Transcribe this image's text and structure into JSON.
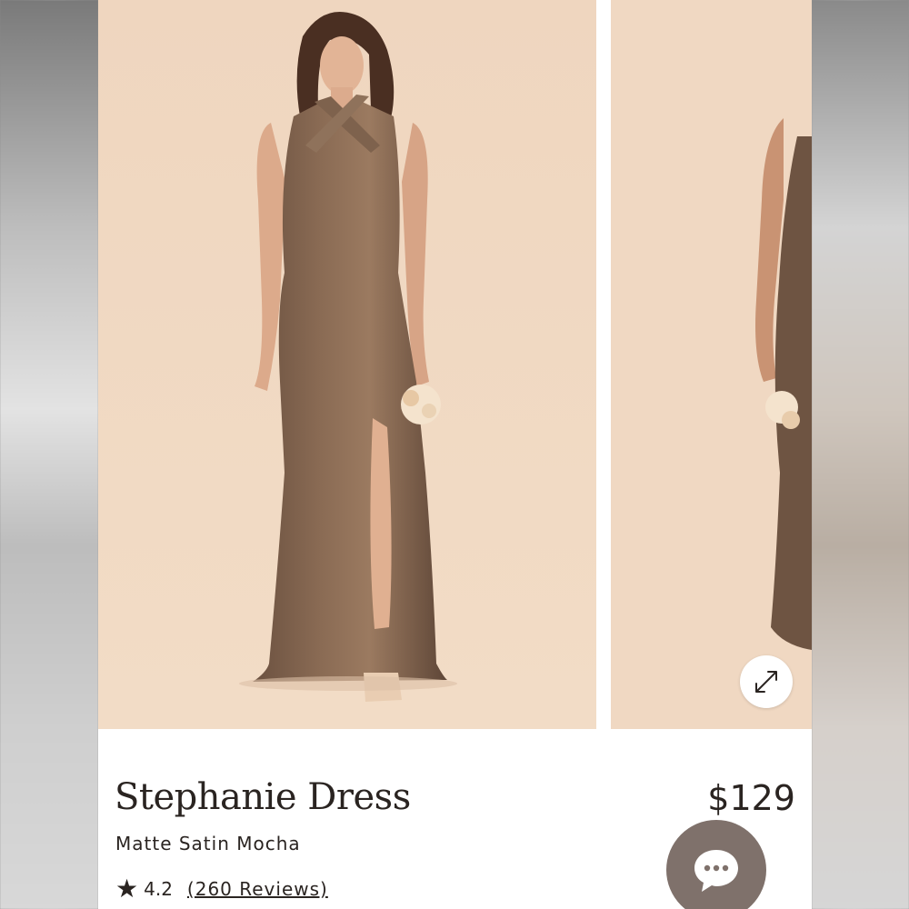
{
  "product": {
    "name": "Stephanie Dress",
    "color": "Matte Satin Mocha",
    "price": "$129",
    "rating": "4.2",
    "reviews": "(260 Reviews)"
  },
  "icons": {
    "rating": "star-icon",
    "expand": "expand-arrows-icon",
    "chat": "chat-bubble-icon"
  },
  "colors": {
    "photo_background": "#efd8c2",
    "dress": "#7a5d47",
    "chat_button": "#7f716b",
    "text": "#2a2421"
  }
}
